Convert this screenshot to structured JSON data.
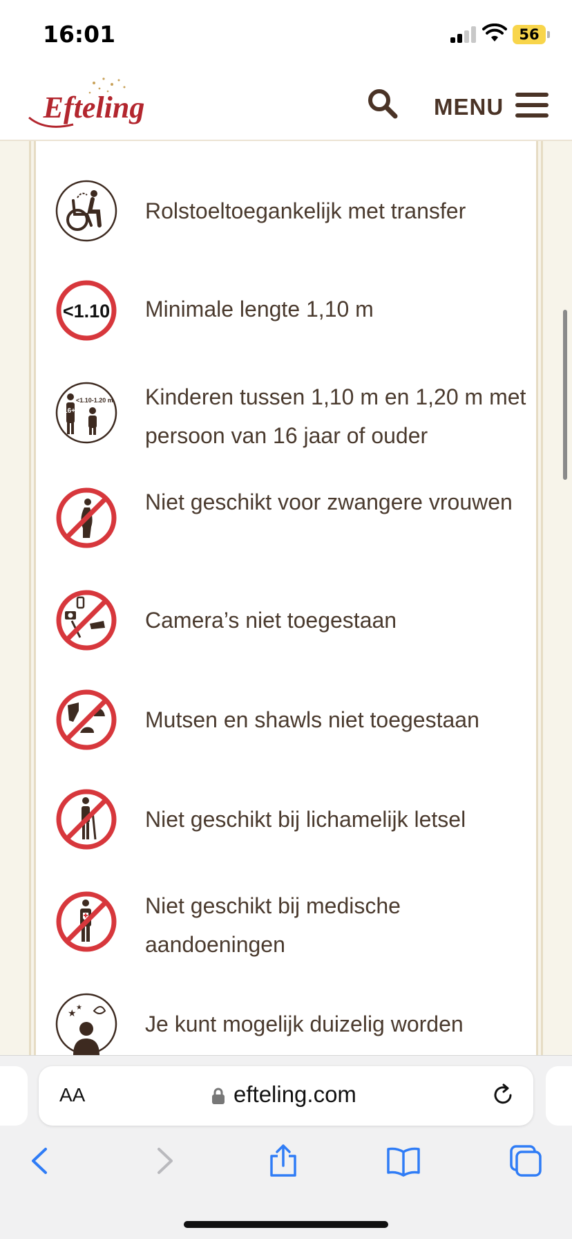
{
  "status_bar": {
    "time": "16:01",
    "battery": "56"
  },
  "header": {
    "logo_text": "Efteling",
    "menu_label": "MENU"
  },
  "items": [
    {
      "icon": "wheelchair-transfer-icon",
      "text": "Rolstoeltoegankelijk met transfer"
    },
    {
      "icon": "min-height-icon",
      "icon_label": "<1.10",
      "text": "Minimale lengte 1,10 m"
    },
    {
      "icon": "children-supervision-icon",
      "icon_label": "<1.10-1.20 m",
      "icon_age": "16+",
      "text": "Kinderen tussen 1,10 m en 1,20 m met persoon van 16 jaar of ouder"
    },
    {
      "icon": "no-pregnant-icon",
      "text": "Niet geschikt voor zwangere vrouwen"
    },
    {
      "icon": "no-camera-icon",
      "text": "Camera’s niet toegestaan"
    },
    {
      "icon": "no-hats-scarves-icon",
      "text": "Mutsen en shawls niet toegestaan"
    },
    {
      "icon": "no-physical-injury-icon",
      "text": "Niet geschikt bij lichamelijk letsel"
    },
    {
      "icon": "no-medical-conditions-icon",
      "text": "Niet geschikt bij medische aandoeningen"
    },
    {
      "icon": "dizziness-icon",
      "text": "Je kunt mogelijk duizelig worden"
    }
  ],
  "browser": {
    "aa_label": "AA",
    "url": "efteling.com"
  },
  "colors": {
    "brand_red": "#b3262e",
    "brown": "#4a3326",
    "sign_red": "#d7373c"
  }
}
